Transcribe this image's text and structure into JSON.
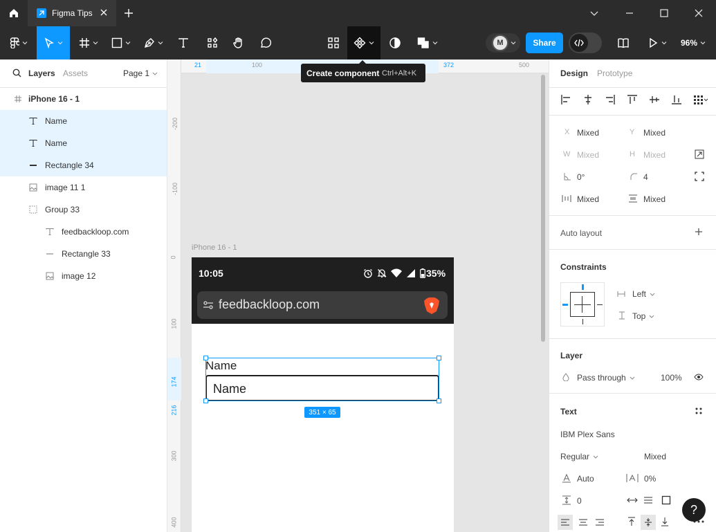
{
  "titlebar": {
    "tab_title": "Figma Tips"
  },
  "toolbar": {
    "zoom": "96%",
    "share_label": "Share",
    "avatar_initials": "M"
  },
  "tooltip": {
    "label": "Create component",
    "shortcut": "Ctrl+Alt+K"
  },
  "left_panel": {
    "tabs": [
      "Layers",
      "Assets"
    ],
    "page": "Page 1",
    "layers": [
      {
        "name": "iPhone 16 - 1",
        "icon": "frame-icon"
      },
      {
        "name": "Name",
        "icon": "text-icon"
      },
      {
        "name": "Name",
        "icon": "text-icon"
      },
      {
        "name": "Rectangle 34",
        "icon": "line-icon"
      },
      {
        "name": "image 11 1",
        "icon": "image-icon"
      },
      {
        "name": "Group 33",
        "icon": "group-icon"
      },
      {
        "name": "feedbackloop.com",
        "icon": "text-icon"
      },
      {
        "name": "Rectangle 33",
        "icon": "line-icon"
      },
      {
        "name": "image 12",
        "icon": "image-icon"
      }
    ]
  },
  "ruler": {
    "top": [
      "21",
      "100",
      "372",
      "500"
    ],
    "left": [
      "-200",
      "-100",
      "0",
      "100",
      "174",
      "216",
      "300",
      "400"
    ]
  },
  "canvas": {
    "frame_label": "iPhone 16 - 1",
    "status_time": "10:05",
    "battery": "35%",
    "url": "feedbackloop.com",
    "field_label": "Name",
    "field_value": "Name",
    "size_badge": "351 × 65"
  },
  "right_panel": {
    "tabs": [
      "Design",
      "Prototype"
    ],
    "x_label": "X",
    "x_value": "Mixed",
    "y_label": "Y",
    "y_value": "Mixed",
    "w_label": "W",
    "w_value": "Mixed",
    "h_label": "H",
    "h_value": "Mixed",
    "rotation": "0°",
    "radius": "4",
    "spacing_a": "Mixed",
    "spacing_b": "Mixed",
    "auto_layout": "Auto layout",
    "constraints": "Constraints",
    "constraint_h": "Left",
    "constraint_v": "Top",
    "layer": "Layer",
    "blend_mode": "Pass through",
    "opacity": "100%",
    "text": "Text",
    "font_family": "IBM Plex Sans",
    "font_weight": "Regular",
    "font_size": "Mixed",
    "line_height": "Auto",
    "letter_spacing": "0%",
    "paragraph_spacing": "0",
    "help": "?"
  },
  "colors": {
    "accent": "#0d99ff",
    "dark_bar": "#2c2c2c",
    "selection": "#e5f4ff"
  }
}
